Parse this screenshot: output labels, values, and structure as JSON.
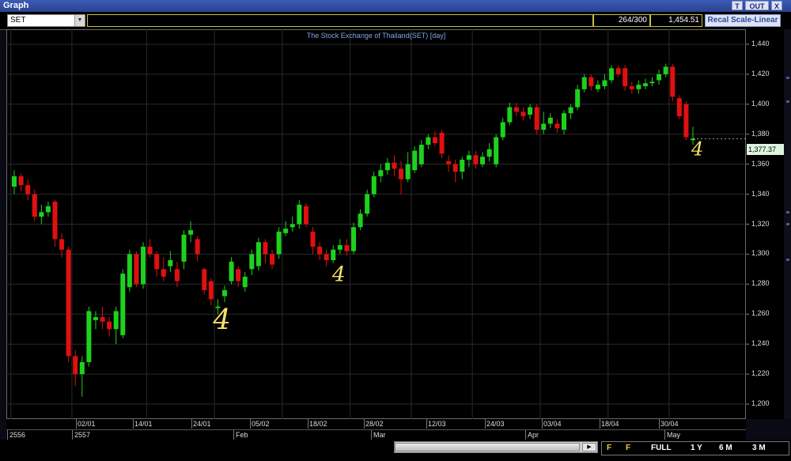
{
  "window": {
    "title": "Graph",
    "btn_t": "T",
    "btn_out": "OUT",
    "btn_close": "X"
  },
  "toolbar": {
    "symbol": "SET",
    "count": "264/300",
    "price": "1,454.51",
    "recal_label": "Recal Scale-Linear"
  },
  "chart_title": "The Stock Exchange of Thailand(SET) [day]",
  "current_price": "1,377.37",
  "x_dates": [
    "02/01",
    "14/01",
    "24/01",
    "05/02",
    "18/02",
    "28/02",
    "12/03",
    "24/03",
    "03/04",
    "18/04",
    "30/04"
  ],
  "x_months": [
    "2556",
    "2557",
    "Feb",
    "Mar",
    "Apr",
    "May"
  ],
  "timeframe_buttons": [
    "F",
    "F",
    "FULL",
    "1 Y",
    "6 M",
    "3 M"
  ],
  "annotations": [
    "4",
    "4",
    "4"
  ],
  "colors": {
    "up": "#1ed11e",
    "down": "#e01010",
    "accent": "#c8c040",
    "title": "#7fa6e8"
  },
  "chart_data": {
    "type": "candlestick",
    "title": "The Stock Exchange of Thailand(SET) [day]",
    "ylim": [
      1190,
      1450
    ],
    "y_ticks": [
      1200,
      1220,
      1240,
      1260,
      1280,
      1300,
      1320,
      1340,
      1360,
      1380,
      1400,
      1420,
      1440
    ],
    "y_tick_labels": [
      "1,200",
      "1,220",
      "1,240",
      "1,260",
      "1,280",
      "1,300",
      "1,320",
      "1,340",
      "1,360",
      "1,380",
      "1,400",
      "1,420",
      "1,440"
    ],
    "x_tick_labels": [
      "02/01",
      "14/01",
      "24/01",
      "05/02",
      "18/02",
      "28/02",
      "12/03",
      "24/03",
      "03/04",
      "18/04",
      "30/04"
    ],
    "candles": [
      [
        1345,
        1352,
        1356,
        1340
      ],
      [
        1352,
        1346,
        1354,
        1342
      ],
      [
        1346,
        1340,
        1350,
        1336
      ],
      [
        1340,
        1325,
        1343,
        1322
      ],
      [
        1325,
        1328,
        1333,
        1320
      ],
      [
        1328,
        1332,
        1335,
        1325
      ],
      [
        1335,
        1310,
        1336,
        1305
      ],
      [
        1310,
        1303,
        1314,
        1298
      ],
      [
        1303,
        1232,
        1305,
        1228
      ],
      [
        1232,
        1220,
        1236,
        1212
      ],
      [
        1220,
        1228,
        1232,
        1205
      ],
      [
        1228,
        1262,
        1265,
        1225
      ],
      [
        1256,
        1258,
        1262,
        1250
      ],
      [
        1258,
        1255,
        1265,
        1250
      ],
      [
        1255,
        1250,
        1258,
        1245
      ],
      [
        1250,
        1262,
        1265,
        1240
      ],
      [
        1246,
        1287,
        1290,
        1244
      ],
      [
        1278,
        1300,
        1303,
        1275
      ],
      [
        1300,
        1280,
        1302,
        1278
      ],
      [
        1280,
        1305,
        1308,
        1277
      ],
      [
        1305,
        1300,
        1310,
        1298
      ],
      [
        1300,
        1290,
        1302,
        1285
      ],
      [
        1290,
        1285,
        1298,
        1282
      ],
      [
        1292,
        1296,
        1302,
        1288
      ],
      [
        1290,
        1282,
        1295,
        1278
      ],
      [
        1295,
        1313,
        1316,
        1290
      ],
      [
        1313,
        1316,
        1322,
        1308
      ],
      [
        1310,
        1300,
        1312,
        1295
      ],
      [
        1290,
        1276,
        1291,
        1273
      ],
      [
        1282,
        1270,
        1284,
        1266
      ],
      [
        1264,
        1265,
        1270,
        1260
      ],
      [
        1272,
        1276,
        1279,
        1268
      ],
      [
        1282,
        1295,
        1298,
        1280
      ],
      [
        1290,
        1282,
        1292,
        1278
      ],
      [
        1278,
        1285,
        1288,
        1275
      ],
      [
        1290,
        1300,
        1303,
        1286
      ],
      [
        1292,
        1308,
        1311,
        1289
      ],
      [
        1308,
        1300,
        1310,
        1294
      ],
      [
        1300,
        1293,
        1303,
        1290
      ],
      [
        1300,
        1315,
        1318,
        1297
      ],
      [
        1314,
        1317,
        1322,
        1312
      ],
      [
        1318,
        1320,
        1325,
        1315
      ],
      [
        1320,
        1333,
        1336,
        1317
      ],
      [
        1332,
        1320,
        1334,
        1318
      ],
      [
        1315,
        1305,
        1318,
        1300
      ],
      [
        1305,
        1300,
        1308,
        1296
      ],
      [
        1300,
        1296,
        1303,
        1292
      ],
      [
        1296,
        1303,
        1306,
        1294
      ],
      [
        1303,
        1306,
        1310,
        1300
      ],
      [
        1306,
        1302,
        1310,
        1299
      ],
      [
        1302,
        1318,
        1321,
        1300
      ],
      [
        1318,
        1327,
        1330,
        1316
      ],
      [
        1327,
        1340,
        1343,
        1325
      ],
      [
        1340,
        1352,
        1355,
        1338
      ],
      [
        1352,
        1356,
        1360,
        1348
      ],
      [
        1356,
        1361,
        1364,
        1353
      ],
      [
        1361,
        1357,
        1366,
        1352
      ],
      [
        1357,
        1350,
        1362,
        1340
      ],
      [
        1350,
        1360,
        1368,
        1348
      ],
      [
        1356,
        1369,
        1372,
        1354
      ],
      [
        1360,
        1373,
        1376,
        1358
      ],
      [
        1373,
        1378,
        1380,
        1370
      ],
      [
        1378,
        1374,
        1382,
        1372
      ],
      [
        1381,
        1367,
        1383,
        1364
      ],
      [
        1362,
        1360,
        1366,
        1355
      ],
      [
        1360,
        1355,
        1363,
        1348
      ],
      [
        1355,
        1363,
        1365,
        1350
      ],
      [
        1363,
        1366,
        1369,
        1358
      ],
      [
        1366,
        1360,
        1369,
        1357
      ],
      [
        1360,
        1365,
        1368,
        1358
      ],
      [
        1365,
        1370,
        1374,
        1362
      ],
      [
        1360,
        1378,
        1380,
        1358
      ],
      [
        1378,
        1388,
        1391,
        1376
      ],
      [
        1388,
        1398,
        1401,
        1386
      ],
      [
        1398,
        1395,
        1401,
        1392
      ],
      [
        1395,
        1392,
        1398,
        1389
      ],
      [
        1393,
        1398,
        1400,
        1390
      ],
      [
        1398,
        1383,
        1400,
        1380
      ],
      [
        1383,
        1387,
        1395,
        1380
      ],
      [
        1387,
        1391,
        1394,
        1384
      ],
      [
        1387,
        1384,
        1390,
        1381
      ],
      [
        1383,
        1394,
        1396,
        1380
      ],
      [
        1394,
        1398,
        1400,
        1390
      ],
      [
        1398,
        1410,
        1413,
        1396
      ],
      [
        1410,
        1418,
        1420,
        1408
      ],
      [
        1418,
        1412,
        1420,
        1409
      ],
      [
        1410,
        1413,
        1416,
        1408
      ],
      [
        1412,
        1416,
        1420,
        1410
      ],
      [
        1416,
        1424,
        1426,
        1414
      ],
      [
        1424,
        1420,
        1426,
        1418
      ],
      [
        1424,
        1412,
        1426,
        1409
      ],
      [
        1412,
        1410,
        1415,
        1407
      ],
      [
        1410,
        1413,
        1416,
        1407
      ],
      [
        1412,
        1414,
        1417,
        1410
      ],
      [
        1414,
        1415,
        1418,
        1412
      ],
      [
        1416,
        1420,
        1423,
        1413
      ],
      [
        1420,
        1425,
        1427,
        1418
      ],
      [
        1425,
        1405,
        1427,
        1402
      ],
      [
        1404,
        1392,
        1406,
        1390
      ],
      [
        1400,
        1378,
        1402,
        1376
      ],
      [
        1376,
        1377,
        1385,
        1373
      ]
    ]
  }
}
